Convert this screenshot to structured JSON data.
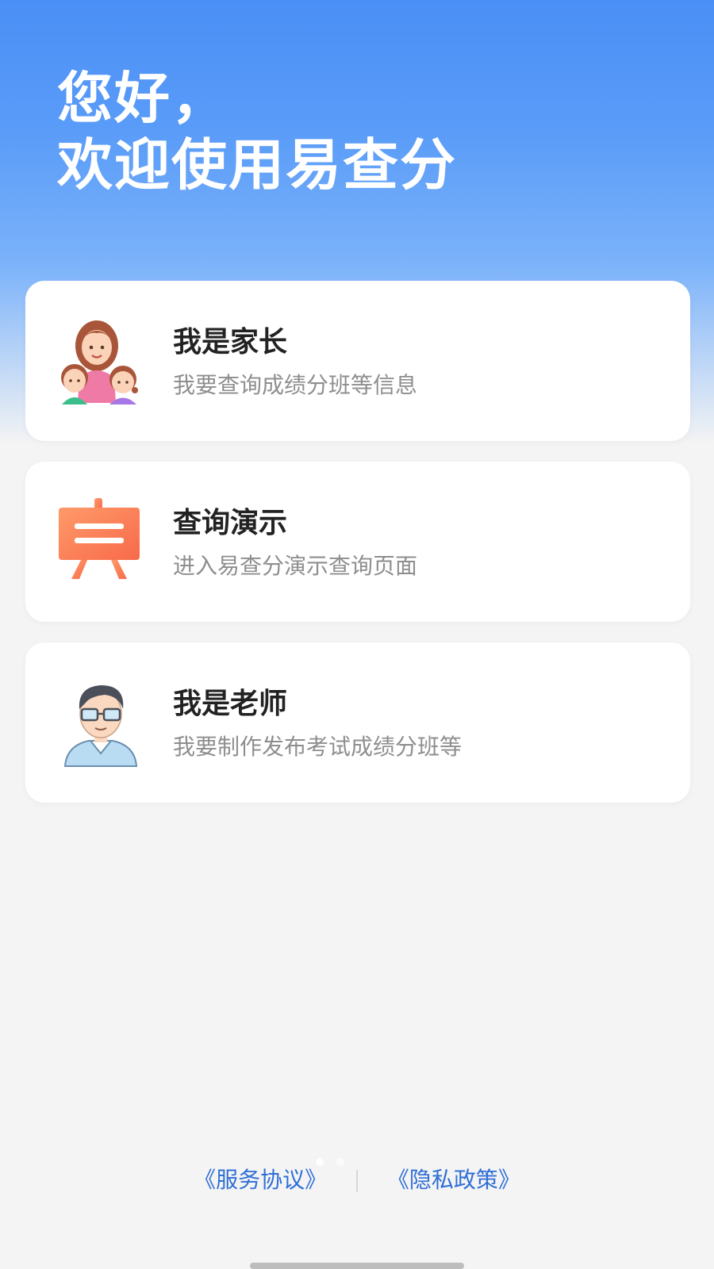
{
  "header": {
    "greeting_line1": "您好，",
    "greeting_line2": "欢迎使用易查分"
  },
  "cards": [
    {
      "title": "我是家长",
      "subtitle": "我要查询成绩分班等信息",
      "icon": "family-icon"
    },
    {
      "title": "查询演示",
      "subtitle": "进入易查分演示查询页面",
      "icon": "presentation-board-icon"
    },
    {
      "title": "我是老师",
      "subtitle": "我要制作发布考试成绩分班等",
      "icon": "teacher-icon"
    }
  ],
  "footer": {
    "service_agreement": "《服务协议》",
    "privacy_policy": "《隐私政策》"
  },
  "colors": {
    "header_blue": "#4a8ff6",
    "link_blue": "#2f6fd6",
    "background": "#f4f4f4"
  }
}
